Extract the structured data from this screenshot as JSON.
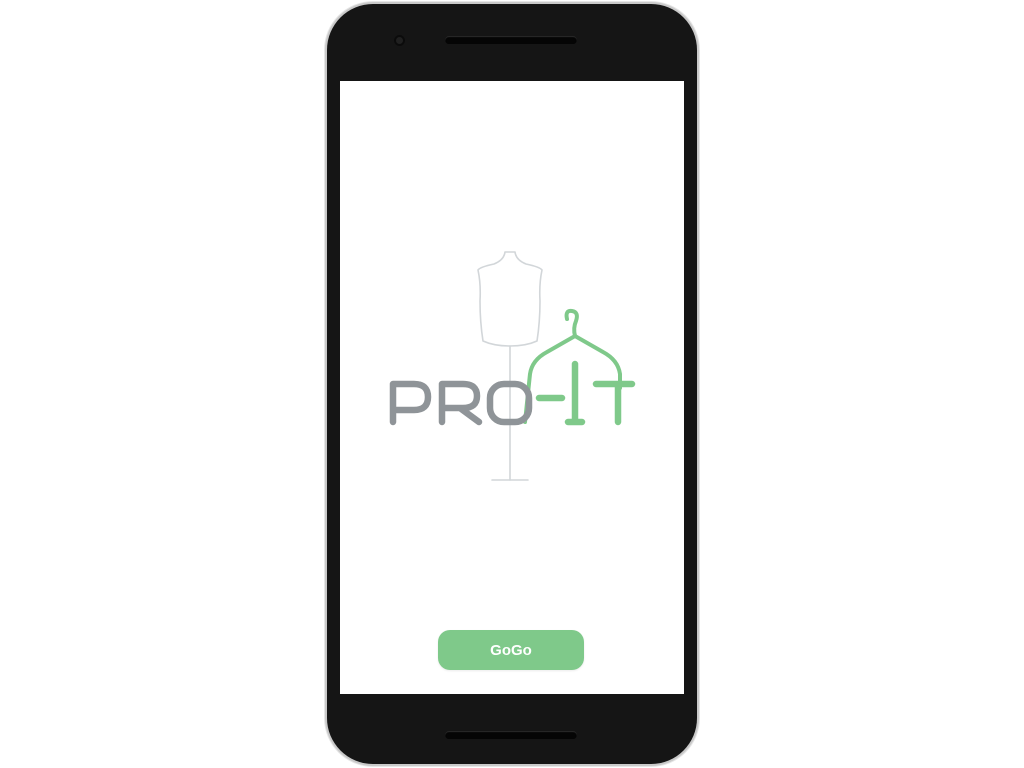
{
  "app": {
    "logo_text": "PROFIT",
    "brand_color": "#7fc98a",
    "logo_grey": "#8f9498",
    "button_label": "GoGo"
  },
  "icons": {
    "logo_figure": "dress-form-icon",
    "logo_hanger": "hanger-icon",
    "camera": "front-camera-icon"
  }
}
